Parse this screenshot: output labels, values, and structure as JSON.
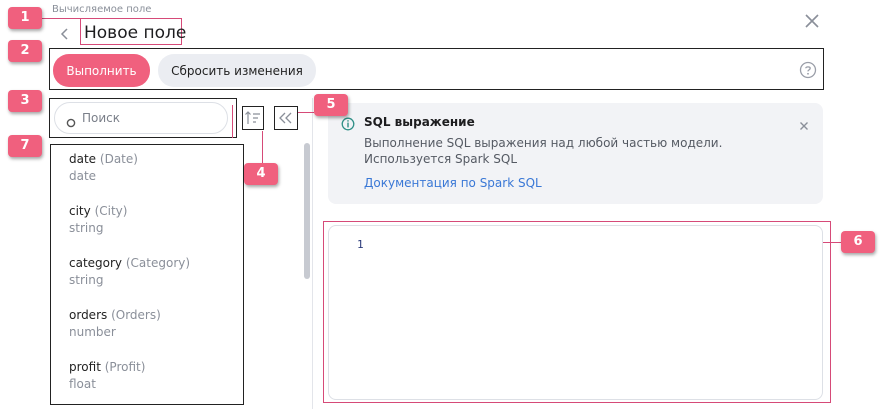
{
  "header": {
    "supertitle": "Вычисляемое поле",
    "title": "Новое поле"
  },
  "toolbar": {
    "run_label": "Выполнить",
    "reset_label": "Сбросить изменения"
  },
  "search": {
    "placeholder": "Поиск"
  },
  "fields": [
    {
      "name": "date",
      "alias": "(Date)",
      "type": "date"
    },
    {
      "name": "city",
      "alias": "(City)",
      "type": "string"
    },
    {
      "name": "category",
      "alias": "(Category)",
      "type": "string"
    },
    {
      "name": "orders",
      "alias": "(Orders)",
      "type": "number"
    },
    {
      "name": "profit",
      "alias": "(Profit)",
      "type": "float"
    }
  ],
  "info": {
    "title": "SQL выражение",
    "description": "Выполнение SQL выражения над любой частью модели. Используется Spark SQL",
    "link": "Документация по Spark SQL"
  },
  "editor": {
    "line_number": "1"
  },
  "annotations": {
    "b1": "1",
    "b2": "2",
    "b3": "3",
    "b4": "4",
    "b5": "5",
    "b6": "6",
    "b7": "7"
  },
  "colors": {
    "accent": "#f0607e",
    "link": "#3a78d6",
    "annotation_outline": "#d64a78"
  }
}
